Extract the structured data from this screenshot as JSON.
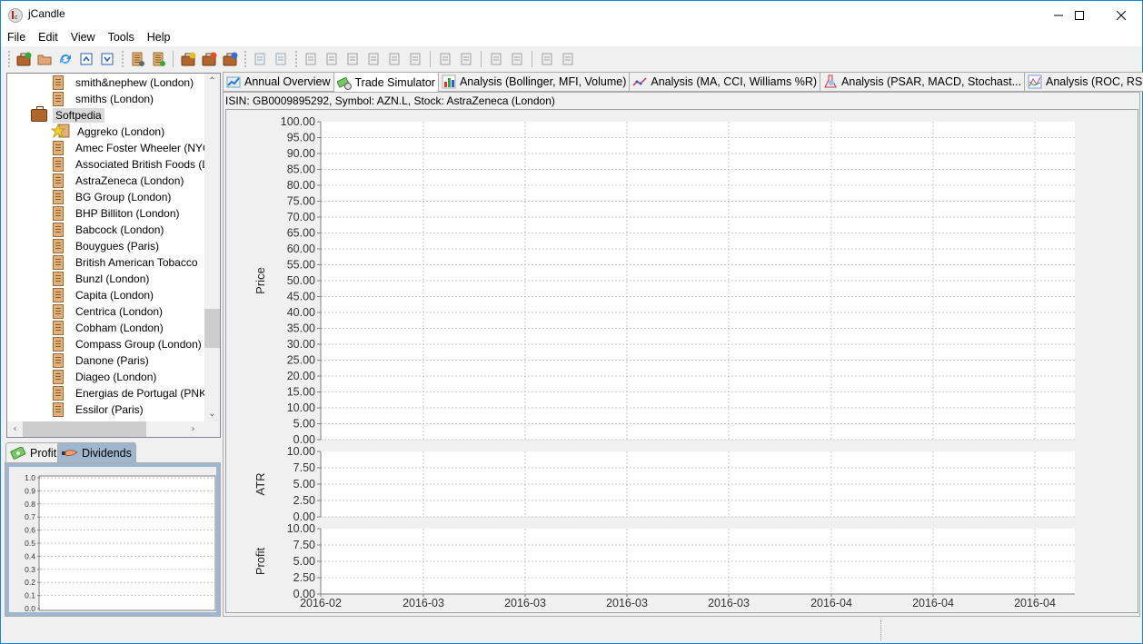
{
  "window": {
    "title": "jCandle",
    "controls": {
      "minimize": "minimize",
      "maximize": "maximize",
      "close": "close"
    }
  },
  "menu": [
    "File",
    "Edit",
    "View",
    "Tools",
    "Help"
  ],
  "toolbar": {
    "groups": [
      [
        "new-portfolio-icon",
        "open-folder-icon",
        "refresh-icon",
        "move-up-icon",
        "move-down-icon"
      ],
      [
        "stock-list-icon",
        "add-stock-icon"
      ],
      [
        "edit-portfolio-icon",
        "delete-portfolio-icon",
        "save-portfolio-icon"
      ],
      [
        "import-icon",
        "export-icon"
      ],
      [
        "chart-settings-icon",
        "favorite-icon",
        "edit-note-icon",
        "document-edit-icon",
        "key-icon",
        "clipboard-icon"
      ],
      [
        "add-transaction-icon",
        "remove-transaction-icon"
      ],
      [
        "add-calculator-icon",
        "remove-calculator-icon"
      ],
      [
        "announce-icon",
        "report-icon"
      ]
    ]
  },
  "tree": {
    "items": [
      {
        "label": "smith&nephew (London)",
        "type": "stock",
        "level": 2
      },
      {
        "label": "smiths (London)",
        "type": "stock",
        "level": 2
      },
      {
        "label": "Softpedia",
        "type": "portfolio",
        "level": 1,
        "selected": true
      },
      {
        "label": "Aggreko (London)",
        "type": "favorite",
        "level": 2
      },
      {
        "label": "Amec Foster Wheeler (NYC",
        "type": "stock",
        "level": 2
      },
      {
        "label": "Associated British Foods (L",
        "type": "stock",
        "level": 2
      },
      {
        "label": "AstraZeneca (London)",
        "type": "stock",
        "level": 2
      },
      {
        "label": "BG Group (London)",
        "type": "stock",
        "level": 2
      },
      {
        "label": "BHP Billiton (London)",
        "type": "stock",
        "level": 2
      },
      {
        "label": "Babcock (London)",
        "type": "stock",
        "level": 2
      },
      {
        "label": "Bouygues (Paris)",
        "type": "stock",
        "level": 2
      },
      {
        "label": "British American Tobacco",
        "type": "stock",
        "level": 2
      },
      {
        "label": "Bunzl (London)",
        "type": "stock",
        "level": 2
      },
      {
        "label": "Capita (London)",
        "type": "stock",
        "level": 2
      },
      {
        "label": "Centrica (London)",
        "type": "stock",
        "level": 2
      },
      {
        "label": "Cobham (London)",
        "type": "stock",
        "level": 2
      },
      {
        "label": "Compass Group (London)",
        "type": "stock",
        "level": 2
      },
      {
        "label": "Danone (Paris)",
        "type": "stock",
        "level": 2
      },
      {
        "label": "Diageo (London)",
        "type": "stock",
        "level": 2
      },
      {
        "label": "Energias de Portugal (PNK",
        "type": "stock",
        "level": 2
      },
      {
        "label": "Essilor (Paris)",
        "type": "stock",
        "level": 2
      }
    ]
  },
  "bottom_left": {
    "tabs": [
      {
        "label": "Profit",
        "active": false
      },
      {
        "label": "Dividends",
        "active": true
      }
    ]
  },
  "main": {
    "tabs": [
      {
        "label": "Annual Overview",
        "icon": "trend-chart-icon",
        "active": false
      },
      {
        "label": "Trade Simulator",
        "icon": "money-clock-icon",
        "active": true
      },
      {
        "label": "Analysis (Bollinger, MFI, Volume)",
        "icon": "bar-chart-icon",
        "active": false
      },
      {
        "label": "Analysis (MA, CCI, Williams %R)",
        "icon": "line-points-icon",
        "active": false
      },
      {
        "label": "Analysis (PSAR, MACD, Stochast...",
        "icon": "flask-icon",
        "active": false
      },
      {
        "label": "Analysis (ROC, RSI, Aroon)",
        "icon": "multi-line-chart-icon",
        "active": false
      }
    ],
    "isin_line": "ISIN: GB0009895292, Symbol: AZN.L, Stock: AstraZeneca (London)"
  },
  "chart_data": [
    {
      "type": "line",
      "title": "",
      "ylabel": "Price",
      "xlabel": "",
      "ylim": [
        0,
        100
      ],
      "yticks": [
        "100.00",
        "95.00",
        "90.00",
        "85.00",
        "80.00",
        "75.00",
        "70.00",
        "65.00",
        "60.00",
        "55.00",
        "50.00",
        "45.00",
        "40.00",
        "35.00",
        "30.00",
        "25.00",
        "20.00",
        "15.00",
        "10.00",
        "5.00",
        "0.00"
      ],
      "series": [],
      "grid": true
    },
    {
      "type": "line",
      "ylabel": "ATR",
      "ylim": [
        0,
        10
      ],
      "yticks": [
        "10.00",
        "7.50",
        "5.00",
        "2.50",
        "0.00"
      ],
      "series": [],
      "grid": true
    },
    {
      "type": "line",
      "ylabel": "Profit",
      "ylim": [
        0,
        10
      ],
      "yticks": [
        "10.00",
        "7.50",
        "5.00",
        "2.50",
        "0.00"
      ],
      "xticks": [
        "2016-02",
        "2016-03",
        "2016-03",
        "2016-03",
        "2016-03",
        "2016-04",
        "2016-04",
        "2016-04"
      ],
      "series": [],
      "grid": true
    },
    {
      "type": "bar",
      "title": "Dividends",
      "ylim": [
        0,
        1
      ],
      "yticks": [
        "1.0",
        "0.9",
        "0.8",
        "0.7",
        "0.6",
        "0.5",
        "0.4",
        "0.3",
        "0.2",
        "0.1",
        "0.0"
      ],
      "series": [],
      "grid": true
    }
  ]
}
